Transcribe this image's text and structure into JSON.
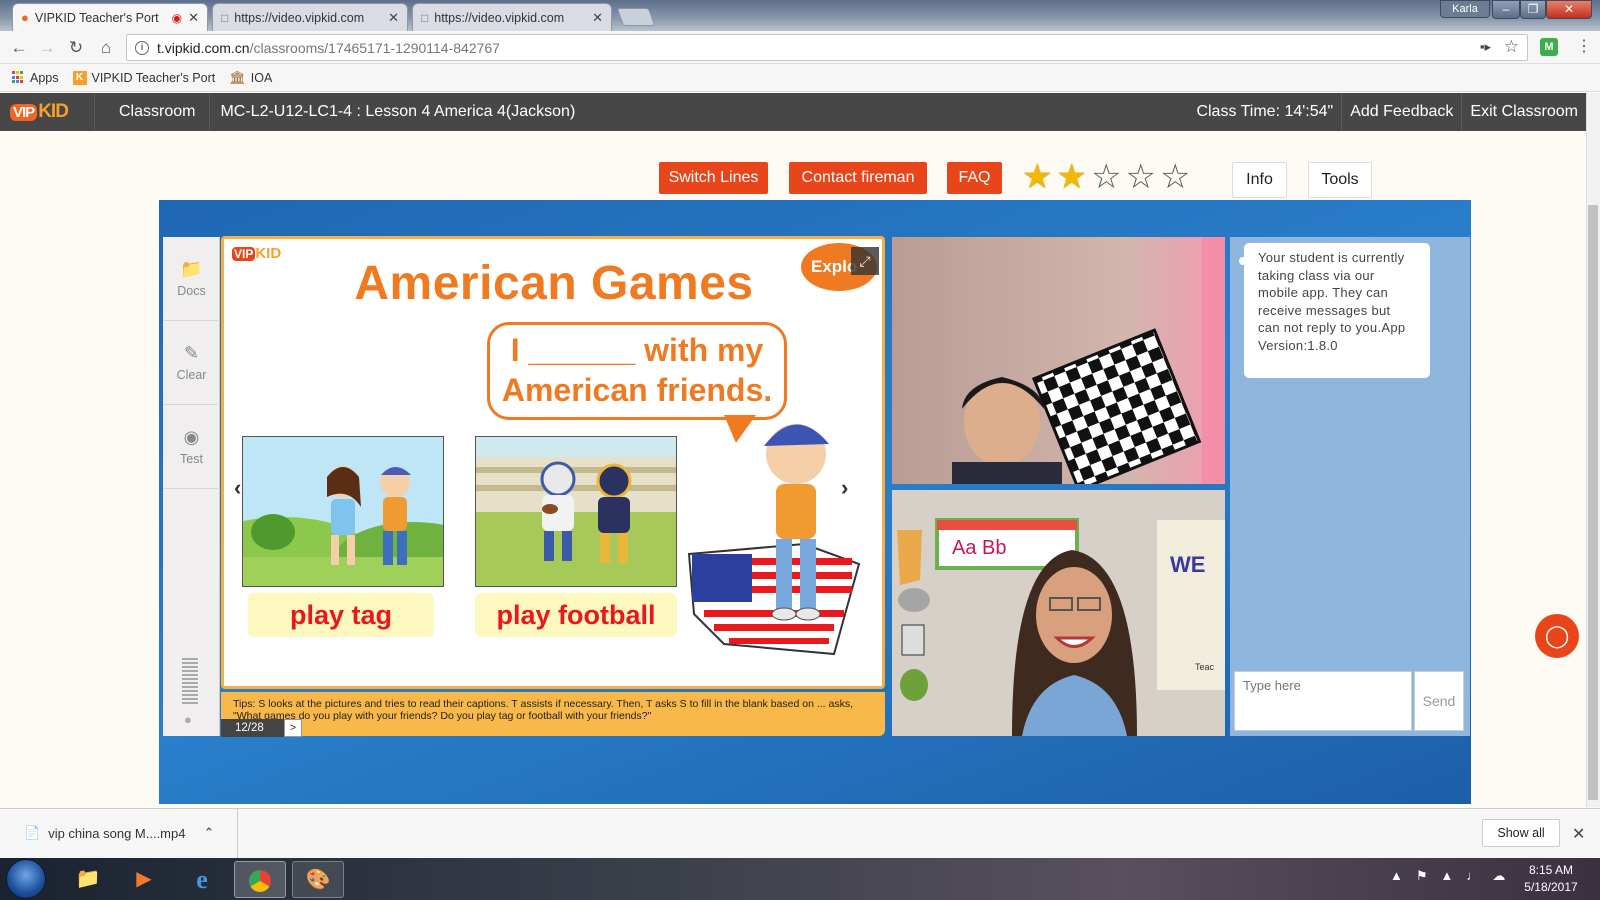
{
  "browser": {
    "tabs": [
      {
        "title": "VIPKID Teacher's Port",
        "active": true,
        "recording": true
      },
      {
        "title": "https://video.vipkid.com",
        "active": false
      },
      {
        "title": "https://video.vipkid.com",
        "active": false
      }
    ],
    "user": "Karla",
    "url_host": "t.vipkid.com.cn",
    "url_path": "/classrooms/17465171-1290114-842767",
    "bookmarks": [
      "Apps",
      "VIPKID Teacher's Port",
      "IOA"
    ]
  },
  "appbar": {
    "logo_vip": "VIP",
    "logo_kid": "KID",
    "section": "Classroom",
    "lesson": "MC-L2-U12-LC1-4 : Lesson 4 America 4(Jackson)",
    "class_time": "Class Time: 14':54\"",
    "add_feedback": "Add Feedback",
    "exit": "Exit Classroom"
  },
  "actions": {
    "switch_lines": "Switch Lines",
    "contact": "Contact fireman",
    "faq": "FAQ",
    "rating": 2,
    "rating_max": 5,
    "info": "Info",
    "tools": "Tools"
  },
  "rail": {
    "docs": "Docs",
    "clear": "Clear",
    "test": "Test"
  },
  "slide": {
    "logo_vip": "VIP",
    "logo_kid": "KID",
    "title": "American Games",
    "explore": "Explo",
    "bubble_line1": "I ______ with my",
    "bubble_line2": "American friends.",
    "caption1": "play tag",
    "caption2": "play football",
    "tips": "Tips: S looks at the pictures and tries to read their captions. T assists if necessary. Then, T asks S to fill in the blank based on ... asks, \"What games do you play with your friends? Do you play tag or football with your friends?\"",
    "page": "12/28",
    "next": ">"
  },
  "chat": {
    "message": "Your student is currently taking class via our mobile app. They can receive messages but can not reply to you.App Version:1.8.0",
    "placeholder": "Type here",
    "send": "Send"
  },
  "teacher_video": {
    "board_text": "Aa  Bb",
    "wall_text": "WE",
    "sign_text": "Teac"
  },
  "downloads": {
    "file": "vip china song M....mp4",
    "show_all": "Show all"
  },
  "taskbar": {
    "time": "8:15 AM",
    "date": "5/18/2017"
  },
  "colors": {
    "accent_orange": "#e8461a",
    "title_orange": "#ef7a22",
    "caption_red": "#e8181c",
    "header_gray": "#474747",
    "classroom_blue": "#2a7fca"
  }
}
